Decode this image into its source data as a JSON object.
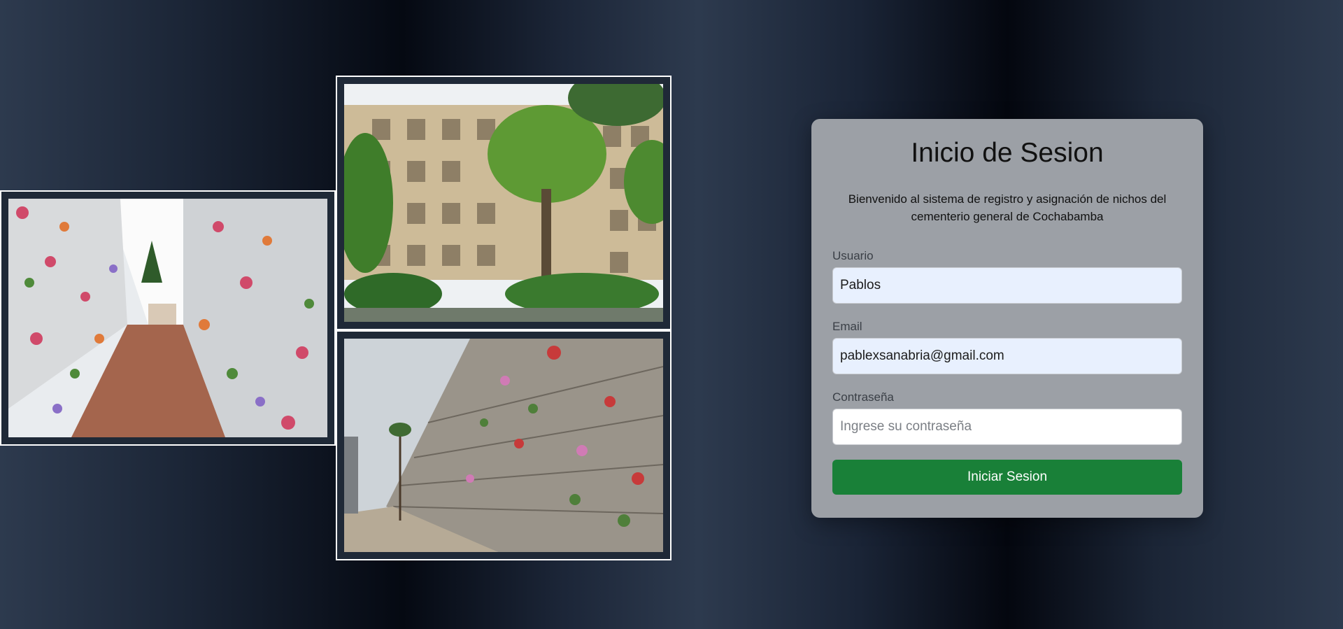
{
  "login": {
    "title": "Inicio de Sesion",
    "subtitle": "Bienvenido al sistema de registro y asignación de nichos del cementerio general de Cochabamba",
    "username": {
      "label": "Usuario",
      "value": "Pablos"
    },
    "email": {
      "label": "Email",
      "value": "pablexsanabria@gmail.com"
    },
    "password": {
      "label": "Contraseña",
      "value": "",
      "placeholder": "Ingrese su contraseña"
    },
    "submit_label": "Iniciar Sesion"
  },
  "photos": [
    {
      "name": "cemetery-corridor-photo"
    },
    {
      "name": "cemetery-wall-trees-photo"
    },
    {
      "name": "cemetery-niche-wall-photo"
    }
  ]
}
